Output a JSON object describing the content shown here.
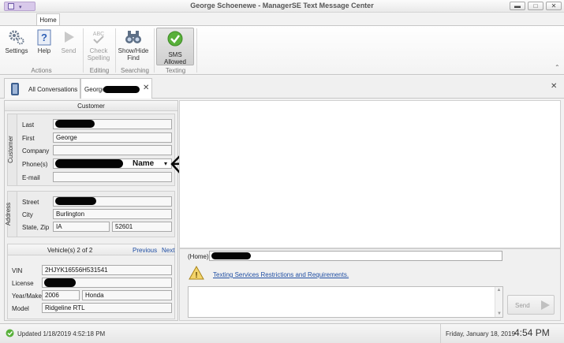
{
  "window": {
    "title": "George Schoenewe - ManagerSE Text Message Center",
    "controls": [
      "minimize-icon",
      "maximize-icon",
      "close-icon"
    ]
  },
  "ribbon": {
    "tab": "Home",
    "buttons": {
      "settings": "Settings",
      "help": "Help",
      "send": "Send",
      "check_spelling_line1": "Check",
      "check_spelling_line2": "Spelling",
      "show_hide_line1": "Show/Hide",
      "show_hide_line2": "Find",
      "sms_allowed": "SMS Allowed"
    },
    "groups": {
      "actions": "Actions",
      "editing": "Editing",
      "searching": "Searching",
      "texting": "Texting"
    }
  },
  "doc_tabs": {
    "all_conversations": "All Conversations",
    "customer_prefix": "George"
  },
  "customer": {
    "header": "Customer",
    "section_label": "Customer",
    "labels": {
      "last": "Last",
      "first": "First",
      "company": "Company",
      "phones": "Phone(s)",
      "email": "E-mail"
    },
    "values": {
      "first": "George",
      "phone_annotation": "Name"
    }
  },
  "address": {
    "section_label": "Address",
    "labels": {
      "street": "Street",
      "city": "City",
      "state_zip": "State, Zip"
    },
    "values": {
      "city": "Burlington",
      "state": "IA",
      "zip": "52601"
    }
  },
  "vehicle": {
    "header": "Vehicle(s) 2 of 2",
    "previous": "Previous",
    "next": "Next",
    "labels": {
      "vin": "VIN",
      "license": "License",
      "year_make": "Year/Make",
      "model": "Model"
    },
    "values": {
      "vin": "2HJYK16556H531541",
      "year": "2006",
      "make": "Honda",
      "model": "Ridgeline RTL"
    }
  },
  "compose": {
    "to_prefix": "(Home)",
    "warning_link": "Texting Services Restrictions and Requirements.",
    "send_label": "Send"
  },
  "status": {
    "updated": "Updated 1/18/2019 4:52:18 PM",
    "date": "Friday, January 18, 2019",
    "time": "4:54 PM"
  },
  "colors": {
    "link": "#1f4ea3",
    "sms_green": "#58b03a",
    "ribbon_icon": "#4a6fb0"
  }
}
